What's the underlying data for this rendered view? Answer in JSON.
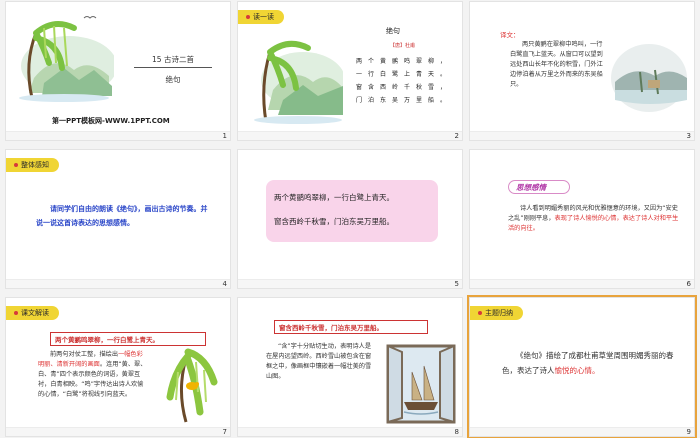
{
  "slides": [
    {
      "num": "1",
      "title": "15 古诗二首",
      "subtitle": "绝句",
      "footer": "第一PPT模板网-WWW.1PPT.COM"
    },
    {
      "num": "2",
      "tag": "读一读",
      "title": "绝句",
      "author": "【唐】杜甫",
      "lines": [
        "两个黄鹂鸣翠柳，",
        "一行白鹭上青天。",
        "窗含西岭千秋雪，",
        "门泊东吴万里船。"
      ]
    },
    {
      "num": "3",
      "label": "译文：",
      "text": "两只黄鹂在翠柳中鸣叫，一行白鹭直飞上蓝天。从窗口可以望到远处西山长年不化的积雪，门外江边停泊着从万里之外而来的东吴船只。"
    },
    {
      "num": "4",
      "tag": "整体感知",
      "text": "请同学们自由的朗读《绝句》，画出古诗的节奏。并说一说这首诗表达的思想感情。"
    },
    {
      "num": "5",
      "line1": "两个黄鹂鸣翠柳，一行白鹭上青天。",
      "line2": "窗含西岭千秋雪，门泊东吴万里船。"
    },
    {
      "num": "6",
      "heading": "思想感情",
      "text_a": "诗人看到明媚秀丽的风光和优雅惬意的环境，又因为“安史之乱”刚刚平息，",
      "text_b": "表现了诗人愉悦的心情，表达了诗人对和平生活的向往。"
    },
    {
      "num": "7",
      "tag": "课文解读",
      "quote": "两个黄鹂鸣翠柳，一行白鹭上青天。",
      "p1": "前两句对仗工整，描绘出",
      "p1_red": "一幅色彩明丽、清新开阔的画面",
      "p2": "。连用“黄、翠、白、青”四个表示颜色的词语，黄翠互衬，白青相映。“鸣”字传达出诗人欢愉的心情，“白鹭”将视线引向蓝天。"
    },
    {
      "num": "8",
      "quote": "窗含西岭千秋雪，门泊东吴万里船。",
      "text": "“含”字十分贴切生动，表明诗人是在屋内远望西岭。西岭雪山被包含在窗框之中，像画框中镶嵌着一幅壮美的雪山图。"
    },
    {
      "num": "9",
      "tag": "主题归纳",
      "text_a": "《绝句》描绘了成都杜甫草堂周围明媚秀丽的春色，表达了诗人",
      "text_b": "愉悦的心情。"
    }
  ]
}
